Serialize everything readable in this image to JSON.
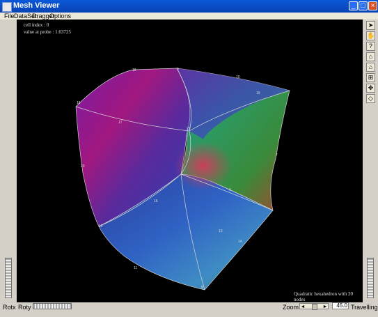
{
  "window": {
    "title": "Mesh Viewer"
  },
  "menu": {
    "items": [
      "File",
      "DataSet",
      "Dragger",
      "Options"
    ]
  },
  "overlay": {
    "cell_index": "cell index : 0",
    "probe_value": "value at probe : 1.63725",
    "caption": "Quadratic hexahedron with 20 nodes"
  },
  "tools": [
    {
      "name": "pointer-icon",
      "glyph": "➤"
    },
    {
      "name": "hand-icon",
      "glyph": "✋"
    },
    {
      "name": "help-icon",
      "glyph": "?"
    },
    {
      "name": "home-icon",
      "glyph": "⌂"
    },
    {
      "name": "set-home-icon",
      "glyph": "⌂"
    },
    {
      "name": "view-all-icon",
      "glyph": "⊞"
    },
    {
      "name": "seek-icon",
      "glyph": "✥"
    },
    {
      "name": "perspective-icon",
      "glyph": "◇"
    }
  ],
  "mesh_nodes": [
    "18",
    "9",
    "10",
    "19",
    "21",
    "17",
    "16",
    "20",
    "7",
    "6",
    "15",
    "12",
    "13",
    "14",
    "11",
    "8"
  ],
  "bottom": {
    "rotx": "Rotx",
    "roty": "Roty",
    "zoom_label": "Zoom",
    "zoom_value": "45.0",
    "mode": "Travelling"
  },
  "colors": {
    "titlebar": "#0b4fc9",
    "viewport_bg": "#000000",
    "chrome": "#d4d0c8"
  }
}
